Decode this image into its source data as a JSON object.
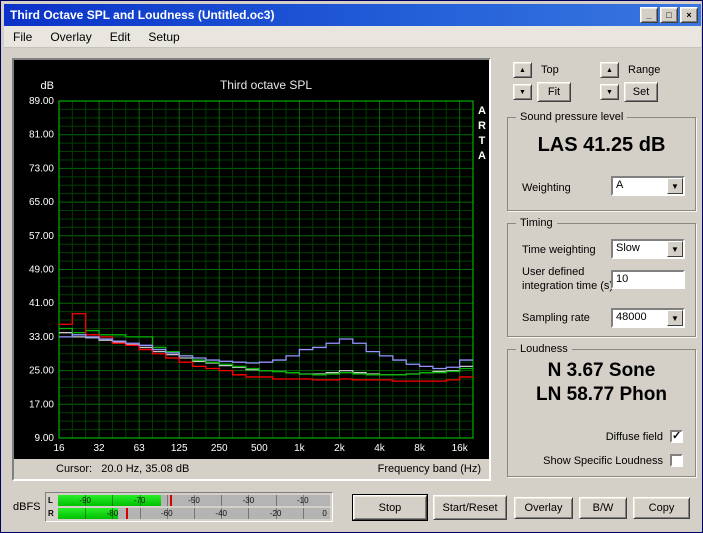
{
  "window": {
    "title": "Third Octave SPL and Loudness (Untitled.oc3)",
    "controls": {
      "minimize": "_",
      "maximize": "□",
      "close": "×"
    }
  },
  "icons": {
    "up": "▲",
    "down": "▼",
    "dropdown": "▼"
  },
  "menu": {
    "items": [
      "File",
      "Overlay",
      "Edit",
      "Setup"
    ]
  },
  "plot": {
    "watermark": "ARTA",
    "cursor_text": "Cursor:   20.0 Hz, 35.08 dB"
  },
  "chart_data": {
    "type": "line",
    "title": "Third octave SPL",
    "ylabel": "dB",
    "xlabel": "Frequency band (Hz)",
    "ylim": [
      9,
      89
    ],
    "y_major_step": 8,
    "y_minor_step": 2,
    "grid": true,
    "legend_position": "none",
    "bands": [
      16,
      20,
      25,
      31.5,
      40,
      50,
      63,
      80,
      100,
      125,
      160,
      200,
      250,
      315,
      400,
      500,
      630,
      800,
      1000,
      1250,
      1600,
      2000,
      2500,
      3150,
      4000,
      5000,
      6300,
      8000,
      10000,
      12500,
      16000
    ],
    "x_ticks": [
      {
        "label": "16",
        "band": 0
      },
      {
        "label": "32",
        "band": 3
      },
      {
        "label": "63",
        "band": 6
      },
      {
        "label": "125",
        "band": 9
      },
      {
        "label": "250",
        "band": 12
      },
      {
        "label": "500",
        "band": 15
      },
      {
        "label": "1k",
        "band": 18
      },
      {
        "label": "2k",
        "band": 21
      },
      {
        "label": "4k",
        "band": 24
      },
      {
        "label": "8k",
        "band": 27
      },
      {
        "label": "16k",
        "band": 30
      }
    ],
    "colors": {
      "background": "#000000",
      "grid_minor": "#003e00",
      "grid_major": "#006a00",
      "grid_border": "#00d400",
      "text": "#ffffff"
    },
    "series": [
      {
        "name": "white",
        "color": "#c8c8c8",
        "values": [
          34.0,
          33.0,
          32.8,
          32.2,
          31.8,
          31.2,
          30.5,
          29.5,
          28.8,
          28.0,
          27.2,
          26.8,
          26.2,
          25.8,
          25.2,
          25.0,
          24.8,
          24.5,
          24.2,
          24.2,
          24.5,
          25.0,
          24.5,
          24.2,
          24.0,
          24.0,
          24.2,
          24.5,
          24.8,
          25.0,
          26.0
        ]
      },
      {
        "name": "green",
        "color": "#00b400",
        "values": [
          35.0,
          34.0,
          34.5,
          33.5,
          33.5,
          33.0,
          33.0,
          30.5,
          29.5,
          28.5,
          27.5,
          27.0,
          26.5,
          26.0,
          25.5,
          25.0,
          24.8,
          24.5,
          24.2,
          24.0,
          24.2,
          24.5,
          24.2,
          24.0,
          24.0,
          24.0,
          24.2,
          24.5,
          24.5,
          24.8,
          25.5
        ]
      },
      {
        "name": "red",
        "color": "#ff0000",
        "values": [
          36.0,
          38.5,
          33.5,
          33.0,
          31.5,
          31.0,
          30.0,
          29.0,
          28.0,
          27.0,
          26.0,
          25.5,
          25.0,
          24.0,
          23.5,
          23.5,
          23.0,
          23.0,
          23.0,
          22.8,
          22.8,
          23.0,
          22.8,
          22.8,
          22.8,
          22.5,
          22.5,
          22.5,
          22.5,
          22.8,
          23.5
        ]
      },
      {
        "name": "blue",
        "color": "#9494ff",
        "values": [
          33.0,
          33.5,
          33.0,
          32.5,
          32.0,
          31.5,
          31.0,
          30.0,
          29.2,
          28.5,
          28.0,
          27.5,
          27.2,
          27.0,
          26.8,
          27.0,
          27.5,
          28.5,
          30.0,
          30.5,
          31.5,
          32.5,
          31.5,
          29.5,
          28.5,
          27.5,
          26.5,
          26.0,
          25.5,
          25.8,
          27.5
        ]
      }
    ]
  },
  "panel": {
    "top_label": "Top",
    "fit_label": "Fit",
    "range_label": "Range",
    "set_label": "Set",
    "spl_group": {
      "legend": "Sound pressure level",
      "value": "LAS 41.25 dB",
      "weighting_label": "Weighting",
      "weighting_value": "A"
    },
    "timing_group": {
      "legend": "Timing",
      "time_weighting_label": "Time weighting",
      "time_weighting_value": "Slow",
      "integration_label": "User defined integration time (s)",
      "integration_value": "10",
      "sampling_label": "Sampling rate",
      "sampling_value": "48000"
    },
    "loudness_group": {
      "legend": "Loudness",
      "n_value": "N 3.67 Sone",
      "ln_value": "LN 58.77 Phon",
      "diffuse_label": "Diffuse field",
      "diffuse_checked": true,
      "specific_label": "Show Specific Loudness",
      "specific_checked": false
    }
  },
  "bottom": {
    "dbfs_label": "dBFS",
    "meters": {
      "channels": [
        {
          "name": "L",
          "level_pct": 38,
          "peak_pct": 41,
          "ticks": [
            {
              "label": "-90",
              "pct": 10
            },
            {
              "label": "-70",
              "pct": 30
            },
            {
              "label": "-50",
              "pct": 50
            },
            {
              "label": "-30",
              "pct": 70
            },
            {
              "label": "-10",
              "pct": 90
            }
          ]
        },
        {
          "name": "R",
          "level_pct": 22,
          "peak_pct": 25,
          "ticks": [
            {
              "label": "-80",
              "pct": 20
            },
            {
              "label": "-60",
              "pct": 40
            },
            {
              "label": "-40",
              "pct": 60
            },
            {
              "label": "-20",
              "pct": 80
            },
            {
              "label": "0",
              "pct": 98
            }
          ]
        }
      ]
    },
    "buttons": [
      {
        "label": "Stop"
      },
      {
        "label": "Start/Reset"
      },
      {
        "label": "Overlay"
      },
      {
        "label": "B/W"
      },
      {
        "label": "Copy"
      }
    ]
  }
}
